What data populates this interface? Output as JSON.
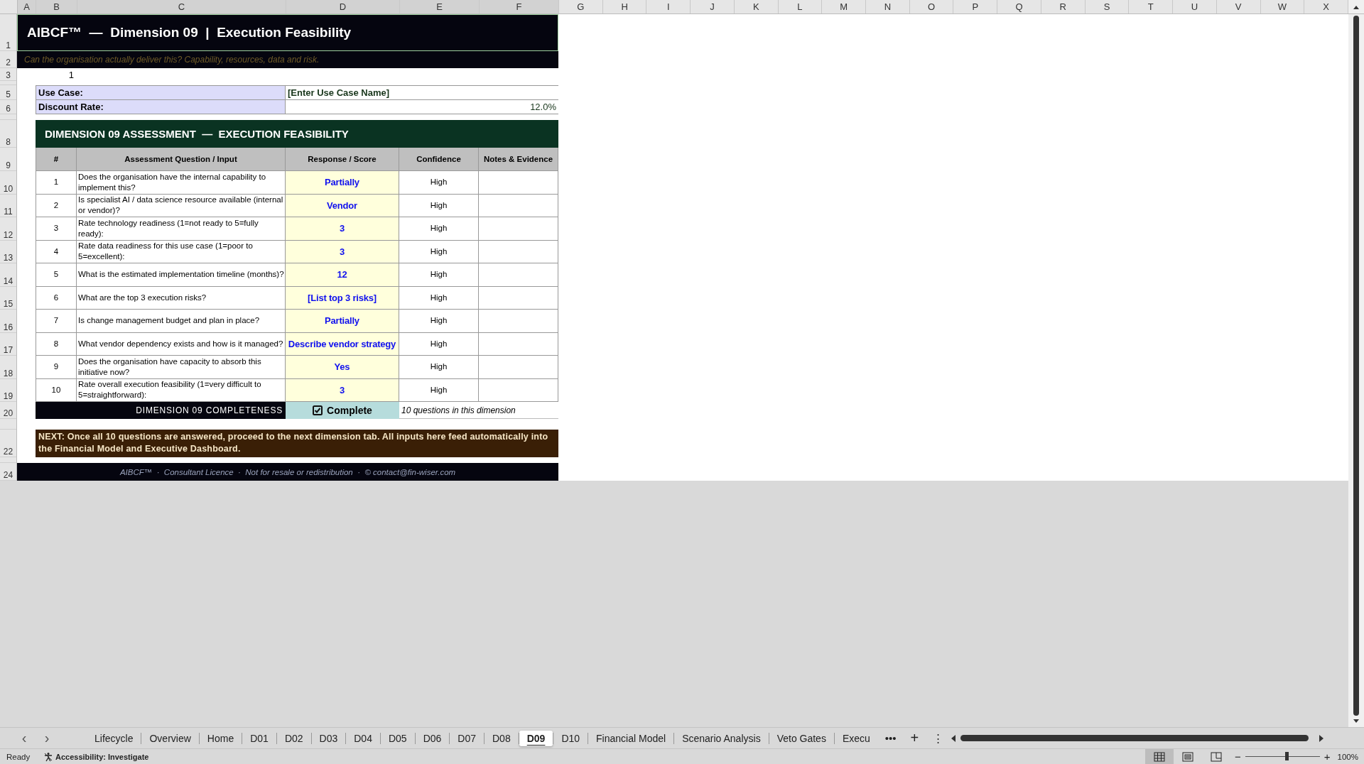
{
  "columns": [
    "A",
    "B",
    "C",
    "D",
    "E",
    "F",
    "G",
    "H",
    "I",
    "J",
    "K",
    "L",
    "M",
    "N",
    "O",
    "P",
    "Q",
    "R",
    "S",
    "T",
    "U",
    "V",
    "W",
    "X"
  ],
  "row_numbers": [
    "1",
    "2",
    "3",
    "5",
    "6",
    "8",
    "9",
    "10",
    "11",
    "12",
    "13",
    "14",
    "15",
    "16",
    "17",
    "18",
    "19",
    "20",
    "22",
    "24"
  ],
  "banner": {
    "title": "AIBCF™  —  Dimension 09  |  Execution Feasibility",
    "subtitle": "Can the organisation actually deliver this? Capability, resources, data and risk."
  },
  "counter": "1",
  "fields": [
    {
      "label": "Use Case:",
      "value": "[Enter Use Case Name]",
      "kind": "text"
    },
    {
      "label": "Discount Rate:",
      "value": "12.0%",
      "kind": "number"
    }
  ],
  "assessment": {
    "title": "DIMENSION 09 ASSESSMENT  —  EXECUTION FEASIBILITY",
    "columns": [
      "#",
      "Assessment Question / Input",
      "Response / Score",
      "Confidence",
      "Notes & Evidence"
    ],
    "rows": [
      {
        "number": "1",
        "question": "Does the organisation have the internal capability to implement this?",
        "response": "Partially",
        "confidence": "High"
      },
      {
        "number": "2",
        "question": "Is specialist AI / data science resource available (internal or vendor)?",
        "response": "Vendor",
        "confidence": "High"
      },
      {
        "number": "3",
        "question": "Rate technology readiness (1=not ready to 5=fully ready):",
        "response": "3",
        "confidence": "High"
      },
      {
        "number": "4",
        "question": "Rate data readiness for this use case (1=poor to 5=excellent):",
        "response": "3",
        "confidence": "High"
      },
      {
        "number": "5",
        "question": "What is the estimated implementation timeline (months)?",
        "response": "12",
        "confidence": "High"
      },
      {
        "number": "6",
        "question": "What are the top 3 execution risks?",
        "response": "[List top 3 risks]",
        "confidence": "High"
      },
      {
        "number": "7",
        "question": "Is change management budget and plan in place?",
        "response": "Partially",
        "confidence": "High"
      },
      {
        "number": "8",
        "question": "What vendor dependency exists and how is it managed?",
        "response": "Describe vendor strategy",
        "confidence": "High"
      },
      {
        "number": "9",
        "question": "Does the organisation have capacity to absorb this initiative now?",
        "response": "Yes",
        "confidence": "High"
      },
      {
        "number": "10",
        "question": "Rate overall execution feasibility (1=very difficult to 5=straightforward):",
        "response": "3",
        "confidence": "High"
      }
    ],
    "completeness": {
      "label": "DIMENSION 09 COMPLETENESS",
      "checked": true,
      "status": "Complete",
      "note": "10 questions in this dimension"
    }
  },
  "next_note": "NEXT:  Once all 10 questions are answered, proceed to the next dimension tab. All inputs here feed automatically into the Financial Model and Executive Dashboard.",
  "footer": "AIBCF™  ·  Consultant Licence  ·  Not for resale or redistribution  ·  © contact@fin-wiser.com",
  "sheet_tabs": [
    {
      "label": "Lifecycle",
      "selected": false
    },
    {
      "label": "Overview",
      "selected": false
    },
    {
      "label": "Home",
      "selected": false
    },
    {
      "label": "D01",
      "selected": false
    },
    {
      "label": "D02",
      "selected": false
    },
    {
      "label": "D03",
      "selected": false
    },
    {
      "label": "D04",
      "selected": false
    },
    {
      "label": "D05",
      "selected": false
    },
    {
      "label": "D06",
      "selected": false
    },
    {
      "label": "D07",
      "selected": false
    },
    {
      "label": "D08",
      "selected": false
    },
    {
      "label": "D09",
      "selected": true
    },
    {
      "label": "D10",
      "selected": false
    },
    {
      "label": "Financial Model",
      "selected": false
    },
    {
      "label": "Scenario Analysis",
      "selected": false
    },
    {
      "label": "Veto Gates",
      "selected": false
    },
    {
      "label": "Execu",
      "selected": false
    }
  ],
  "tab_nav": {
    "prev": "‹",
    "next": "›",
    "more": "•••",
    "add": "+",
    "menu": "⋮"
  },
  "status_bar": {
    "state": "Ready",
    "accessibility": "Accessibility: Investigate",
    "zoom": {
      "level": 0.55
    },
    "zoom_out": "−",
    "zoom_in": "+",
    "zoom_label": "100%"
  }
}
